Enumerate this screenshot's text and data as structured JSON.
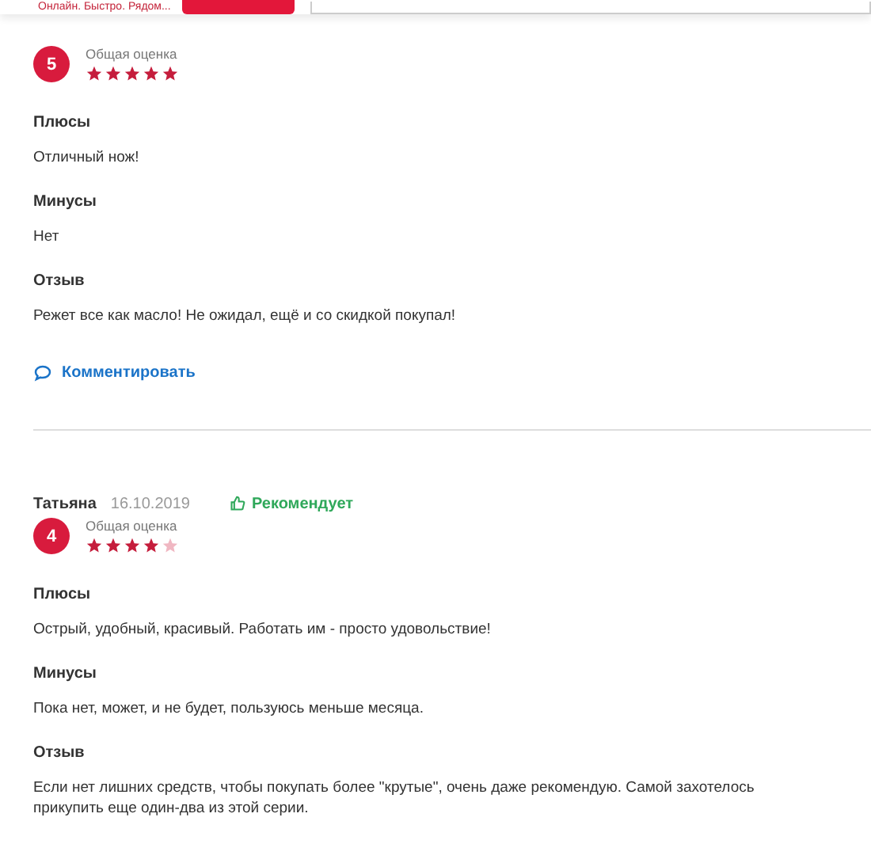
{
  "header": {
    "tagline": "Онлайн. Быстро. Рядом..."
  },
  "reviews": [
    {
      "rating": "5",
      "rating_label": "Общая оценка",
      "stars": 5,
      "sections": [
        {
          "title": "Плюсы",
          "text": "Отличный нож!"
        },
        {
          "title": "Минусы",
          "text": "Нет"
        },
        {
          "title": "Отзыв",
          "text": "Режет все как масло! Не ожидал, ещё и со скидкой покупал!"
        }
      ],
      "comment_link": "Комментировать"
    },
    {
      "author": "Татьяна",
      "date": "16.10.2019",
      "recommends": "Рекомендует",
      "rating": "4",
      "rating_label": "Общая оценка",
      "stars": 4,
      "sections": [
        {
          "title": "Плюсы",
          "text": "Острый, удобный, красивый. Работать им - просто удовольствие!"
        },
        {
          "title": "Минусы",
          "text": "Пока нет, может, и не будет, пользуюсь меньше месяца."
        },
        {
          "title": "Отзыв",
          "text": "Если нет лишних средств, чтобы покупать более \"крутые\", очень даже рекомендую. Самой захотелось прикупить еще один-два из этой серии."
        }
      ]
    }
  ]
}
